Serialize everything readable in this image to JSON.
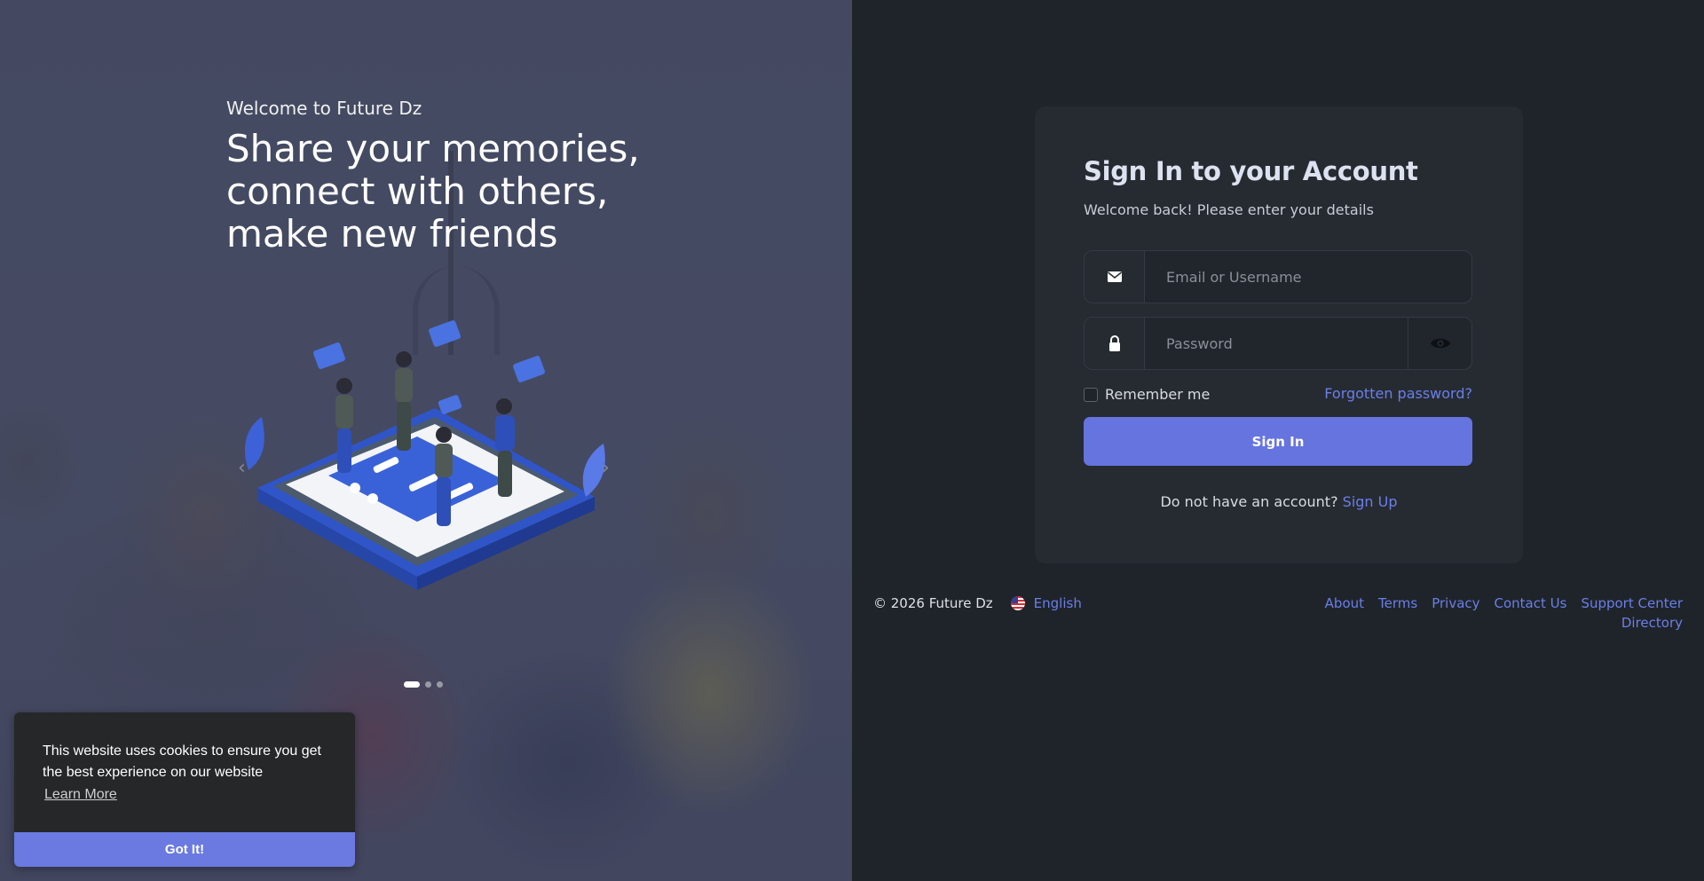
{
  "hero": {
    "welcome": "Welcome to Future Dz",
    "headline": [
      "Share your memories,",
      "connect with others,",
      "make new friends"
    ],
    "carousel": {
      "slides": 3,
      "active_index": 0,
      "prev_icon": "chevron-left-icon",
      "next_icon": "chevron-right-icon"
    }
  },
  "cookie": {
    "message": "This website uses cookies to ensure you get the best experience on our website",
    "learn_more": "Learn More",
    "accept": "Got It!"
  },
  "login": {
    "title": "Sign In to your Account",
    "subtitle": "Welcome back! Please enter your details",
    "email_placeholder": "Email or Username",
    "password_placeholder": "Password",
    "remember_label": "Remember me",
    "forgot_label": "Forgotten password?",
    "submit_label": "Sign In",
    "no_account_text": "Do not have an account?",
    "signup_label": "Sign Up",
    "icons": {
      "email": "envelope-icon",
      "password": "lock-icon",
      "toggle": "eye-icon"
    }
  },
  "footer": {
    "copyright": "© 2026 Future Dz",
    "language": "English",
    "language_flag": "us-flag-icon",
    "links": [
      "About",
      "Terms",
      "Privacy",
      "Contact Us",
      "Support Center",
      "Directory"
    ]
  },
  "colors": {
    "accent": "#6674e0",
    "link": "#6b7fe8",
    "panel_bg": "#1f242a",
    "card_bg": "#262b32"
  }
}
